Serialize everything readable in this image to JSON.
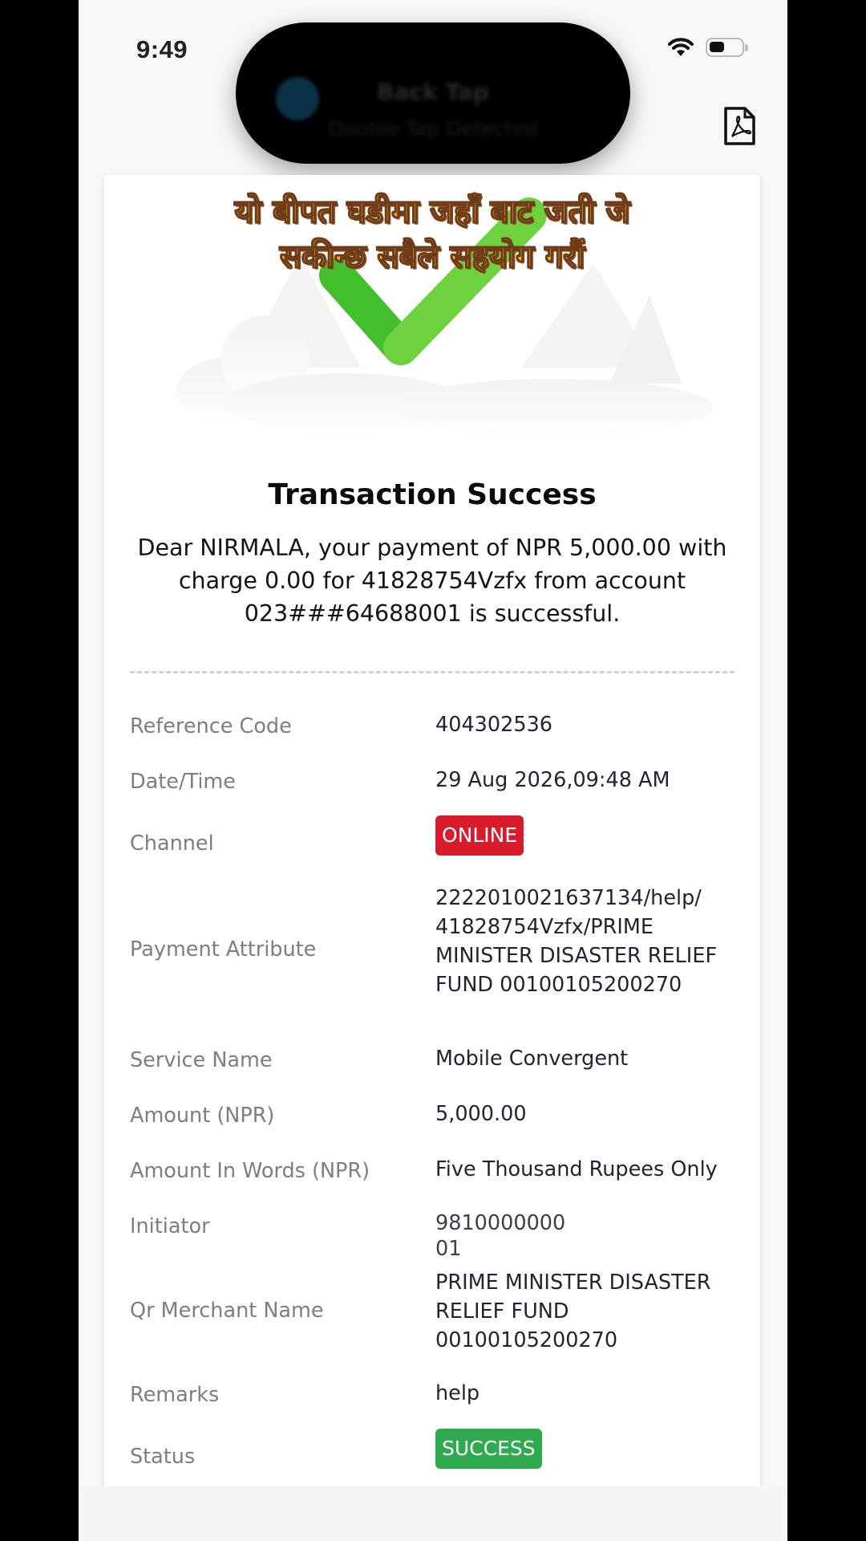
{
  "status_bar": {
    "time": "9:49"
  },
  "island": {
    "title": "Back Tap",
    "subtitle": "Double Tap Detected"
  },
  "overlay_caption": [
    "यो बीपत  घडीमा जहाँ बाट जती जे",
    "सकीन्छ सबैले सहयोग गरौं"
  ],
  "title": "Transaction Success",
  "message": "Dear NIRMALA, your payment of NPR 5,000.00 with charge 0.00 for 41828754Vzfx from account 023###64688001 is successful.",
  "details": [
    {
      "label": "Reference Code",
      "value": "404302536"
    },
    {
      "label": "Date/Time",
      "value": "29 Aug 2026,09:48 AM"
    },
    {
      "label": "Channel",
      "value": "ONLINE"
    },
    {
      "label": "Payment Attribute",
      "value": "2222010021637134/help/\n41828754Vzfx/PRIME\nMINISTER DISASTER RELIEF\nFUND 00100105200270"
    },
    {
      "label": "Service Name",
      "value": "Mobile Convergent"
    },
    {
      "label": "Amount (NPR)",
      "value": "5,000.00"
    },
    {
      "label": "Amount In Words (NPR)",
      "value": "Five Thousand Rupees Only"
    },
    {
      "label": "Initiator",
      "value": "9810000000\n01"
    },
    {
      "label": "Qr Merchant Name",
      "value": "PRIME MINISTER DISASTER\nRELIEF FUND\n00100105200270"
    },
    {
      "label": "Remarks",
      "value": "help"
    },
    {
      "label": "Status",
      "value": "SUCCESS"
    }
  ],
  "colors": {
    "online_badge": "#d71b2a",
    "success_badge": "#2faa4f",
    "check_green": "#4cc134"
  },
  "icons": {
    "pdf": "pdf-file-icon",
    "check": "check-mark-icon"
  }
}
